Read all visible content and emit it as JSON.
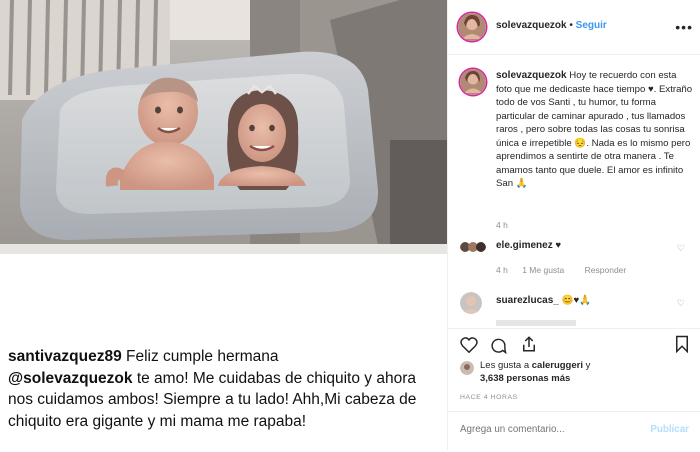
{
  "caption": {
    "username": "santivazquez89",
    "text_1": " Feliz cumple hermana",
    "mention": "@solevazquezok",
    "text_2": " te amo! Me cuidabas de chiquito y ahora nos cuidamos ambos! Siempre a tu lado! Ahh,Mi cabeza de chiquito era gigante y mi mama me rapaba!"
  },
  "header": {
    "username": "solevazquezok",
    "separator": " • ",
    "follow_label": "Seguir",
    "more_icon": "ellipsis-icon"
  },
  "post": {
    "username": "solevazquezok",
    "text": " Hoy te recuerdo con esta foto que me dedicaste hace tiempo ♥. Extraño todo de vos Santi , tu humor, tu forma particular de caminar apurado , tus llamados raros , pero sobre todas las cosas tu sonrisa única e irrepetible 😔. Nada es lo mismo pero aprendimos a sentirte de otra manera . Te amamos tanto que duele. El amor es infinito San 🙏",
    "time": "4 h"
  },
  "comments": [
    {
      "username": "ele.gimenez",
      "text": " ♥",
      "time": "4 h",
      "likes": "1 Me gusta",
      "reply": "Responder"
    },
    {
      "username": "suarezlucas_",
      "text": " 😊♥🙏",
      "time": "",
      "likes": "",
      "reply": ""
    }
  ],
  "actions": {
    "like_icon": "heart-icon",
    "comment_icon": "comment-icon",
    "share_icon": "share-icon",
    "save_icon": "bookmark-icon",
    "likes_prefix": "Les gusta a ",
    "likes_user": "caleruggeri",
    "likes_mid": " y",
    "likes_count": "3,638 personas más",
    "time_ago": "HACE 4 HORAS"
  },
  "comment_box": {
    "placeholder": "Agrega un comentario...",
    "publish_label": "Publicar"
  },
  "colors": {
    "link_blue": "#3897f0",
    "publish_disabled": "#b2dffc",
    "muted": "#8e8e8e",
    "text": "#262626",
    "border": "#efefef"
  }
}
